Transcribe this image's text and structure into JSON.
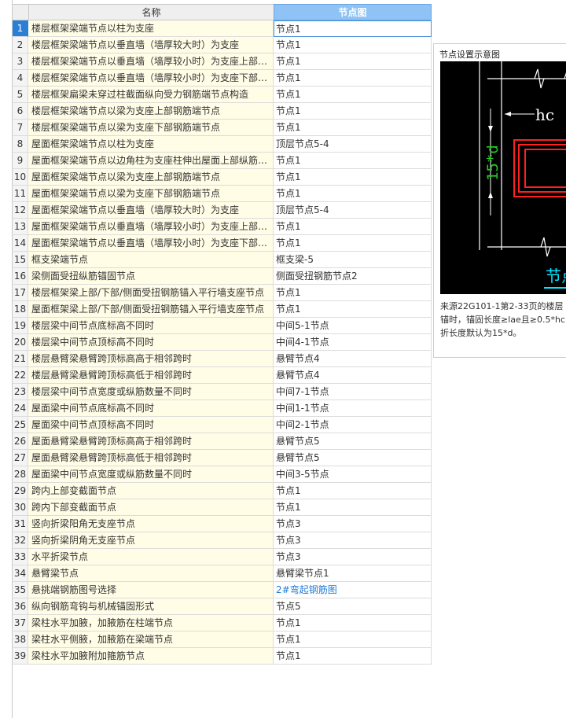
{
  "table": {
    "headers": {
      "name": "名称",
      "node": "节点图"
    },
    "selected_row": 0,
    "rows": [
      {
        "index": "1",
        "name": "楼层框架梁端节点以柱为支座",
        "node": "节点1"
      },
      {
        "index": "2",
        "name": "楼层框架梁端节点以垂直墙（墙厚较大时）为支座",
        "node": "节点1"
      },
      {
        "index": "3",
        "name": "楼层框架梁端节点以垂直墙（墙厚较小时）为支座上部…",
        "node": "节点1"
      },
      {
        "index": "4",
        "name": "楼层框架梁端节点以垂直墙（墙厚较小时）为支座下部…",
        "node": "节点1"
      },
      {
        "index": "5",
        "name": "楼层框架扁梁未穿过柱截面纵向受力钢筋端节点构造",
        "node": "节点1"
      },
      {
        "index": "6",
        "name": "楼层框架梁端节点以梁为支座上部钢筋端节点",
        "node": "节点1"
      },
      {
        "index": "7",
        "name": "楼层框架梁端节点以梁为支座下部钢筋端节点",
        "node": "节点1"
      },
      {
        "index": "8",
        "name": "屋面框架梁端节点以柱为支座",
        "node": "顶层节点5-4"
      },
      {
        "index": "9",
        "name": "屋面框架梁端节点以边角柱为支座柱伸出屋面上部纵筋…",
        "node": "节点1"
      },
      {
        "index": "10",
        "name": "屋面框架梁端节点以梁为支座上部钢筋端节点",
        "node": "节点1"
      },
      {
        "index": "11",
        "name": "屋面框架梁端节点以梁为支座下部钢筋端节点",
        "node": "节点1"
      },
      {
        "index": "12",
        "name": "屋面框架梁端节点以垂直墙（墙厚较大时）为支座",
        "node": "顶层节点5-4"
      },
      {
        "index": "13",
        "name": "屋面框架梁端节点以垂直墙（墙厚较小时）为支座上部…",
        "node": "节点1"
      },
      {
        "index": "14",
        "name": "屋面框架梁端节点以垂直墙（墙厚较小时）为支座下部…",
        "node": "节点1"
      },
      {
        "index": "15",
        "name": "框支梁端节点",
        "node": "框支梁-5"
      },
      {
        "index": "16",
        "name": "梁侧面受扭纵筋锚固节点",
        "node": "侧面受扭钢筋节点2"
      },
      {
        "index": "17",
        "name": "楼层框架梁上部/下部/侧面受扭钢筋锚入平行墙支座节点",
        "node": "节点1"
      },
      {
        "index": "18",
        "name": "屋面框架梁上部/下部/侧面受扭钢筋锚入平行墙支座节点",
        "node": "节点1"
      },
      {
        "index": "19",
        "name": "楼层梁中间节点底标高不同时",
        "node": "中间5-1节点"
      },
      {
        "index": "20",
        "name": "楼层梁中间节点顶标高不同时",
        "node": "中间4-1节点"
      },
      {
        "index": "21",
        "name": "楼层悬臂梁悬臂跨顶标高高于相邻跨时",
        "node": "悬臂节点4"
      },
      {
        "index": "22",
        "name": "楼层悬臂梁悬臂跨顶标高低于相邻跨时",
        "node": "悬臂节点4"
      },
      {
        "index": "23",
        "name": "楼层梁中间节点宽度或纵筋数量不同时",
        "node": "中间7-1节点"
      },
      {
        "index": "24",
        "name": "屋面梁中间节点底标高不同时",
        "node": "中间1-1节点"
      },
      {
        "index": "25",
        "name": "屋面梁中间节点顶标高不同时",
        "node": "中间2-1节点"
      },
      {
        "index": "26",
        "name": "屋面悬臂梁悬臂跨顶标高高于相邻跨时",
        "node": "悬臂节点5"
      },
      {
        "index": "27",
        "name": "屋面悬臂梁悬臂跨顶标高低于相邻跨时",
        "node": "悬臂节点5"
      },
      {
        "index": "28",
        "name": "屋面梁中间节点宽度或纵筋数量不同时",
        "node": "中间3-5节点"
      },
      {
        "index": "29",
        "name": "跨内上部变截面节点",
        "node": "节点1"
      },
      {
        "index": "30",
        "name": "跨内下部变截面节点",
        "node": "节点1"
      },
      {
        "index": "31",
        "name": "竖向折梁阳角无支座节点",
        "node": "节点3"
      },
      {
        "index": "32",
        "name": "竖向折梁阴角无支座节点",
        "node": "节点3"
      },
      {
        "index": "33",
        "name": "水平折梁节点",
        "node": "节点3"
      },
      {
        "index": "34",
        "name": "悬臂梁节点",
        "node": "悬臂梁节点1"
      },
      {
        "index": "35",
        "name": "悬挑端钢筋图号选择",
        "node": "2#弯起钢筋图",
        "link": true
      },
      {
        "index": "36",
        "name": "纵向钢筋弯钩与机械锚固形式",
        "node": "节点5"
      },
      {
        "index": "37",
        "name": "梁柱水平加腋，加腋筋在柱端节点",
        "node": "节点1"
      },
      {
        "index": "38",
        "name": "梁柱水平侧腋，加腋筋在梁端节点",
        "node": "节点1"
      },
      {
        "index": "39",
        "name": "梁柱水平加腋附加箍筋节点",
        "node": "节点1"
      }
    ]
  },
  "panel": {
    "title": "节点设置示意图",
    "diagram": {
      "hc_label": "hc",
      "vertical_label": "15*d",
      "caption": "节点"
    },
    "description_lines": [
      "来源22G101-1第2-33页的楼层",
      "锚时，锚固长度≥lae且≥0.5*hc",
      "折长度默认为15*d。"
    ]
  },
  "colors": {
    "header_selected": "#8fc2f5",
    "row_index_selected": "#2a7fd4",
    "name_cell_bg": "#fffde6",
    "link_text": "#1e7ad6",
    "diagram_bg": "#000000",
    "rebar_red": "#ff2020",
    "dimension_green": "#22cc22",
    "caption_cyan": "#00e5ff"
  }
}
